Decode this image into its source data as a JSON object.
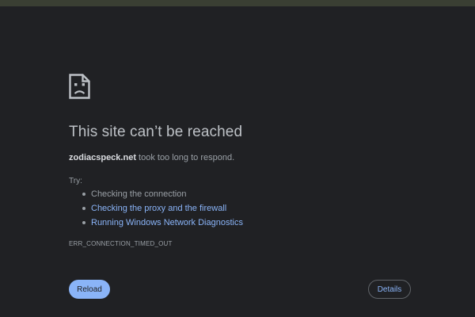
{
  "page": {
    "icon": "sad-page-icon",
    "title": "This site can’t be reached",
    "domain": "zodiacspeck.net",
    "description_suffix": " took too long to respond.",
    "try_label": "Try:",
    "suggestions": [
      {
        "text": "Checking the connection",
        "is_link": false
      },
      {
        "text": "Checking the proxy and the firewall",
        "is_link": true
      },
      {
        "text": "Running Windows Network Diagnostics",
        "is_link": true
      }
    ],
    "error_code": "ERR_CONNECTION_TIMED_OUT"
  },
  "buttons": {
    "reload_label": "Reload",
    "details_label": "Details"
  },
  "colors": {
    "background": "#202124",
    "top_strip": "#3a3f33",
    "title": "#bdc1c6",
    "text": "#9aa0a6",
    "link": "#8ab4f8",
    "primary_button": "#8ab4f8"
  }
}
